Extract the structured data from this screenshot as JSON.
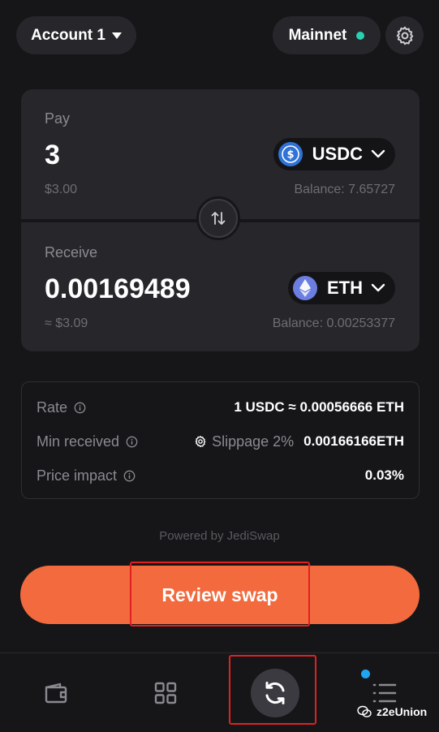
{
  "header": {
    "account_label": "Account 1",
    "network_label": "Mainnet",
    "network_status_color": "#2ad0b0",
    "settings_icon": "gear-icon"
  },
  "swap": {
    "pay": {
      "label": "Pay",
      "amount": "3",
      "usd_value": "$3.00",
      "token": "USDC",
      "token_icon": "usdc-icon",
      "balance": "Balance: 7.65727"
    },
    "receive": {
      "label": "Receive",
      "amount": "0.00169489",
      "usd_value": "≈ $3.09",
      "token": "ETH",
      "token_icon": "eth-icon",
      "balance": "Balance: 0.00253377"
    }
  },
  "details": {
    "rate_label": "Rate",
    "rate_value": "1 USDC ≈ 0.00056666 ETH",
    "min_received_label": "Min received",
    "slippage_label": "Slippage 2%",
    "min_received_value": "0.00166166ETH",
    "price_impact_label": "Price impact",
    "price_impact_value": "0.03%"
  },
  "powered_by": "Powered by JediSwap",
  "review_button_label": "Review swap",
  "colors": {
    "accent": "#f26a3d",
    "highlight_box": "#e32020",
    "notification_dot": "#1ea7f0"
  },
  "nav": {
    "items": [
      "wallet-icon",
      "apps-grid-icon",
      "swap-icon",
      "activity-list-icon"
    ],
    "active": "swap-icon"
  },
  "watermark": "z2eUnion"
}
